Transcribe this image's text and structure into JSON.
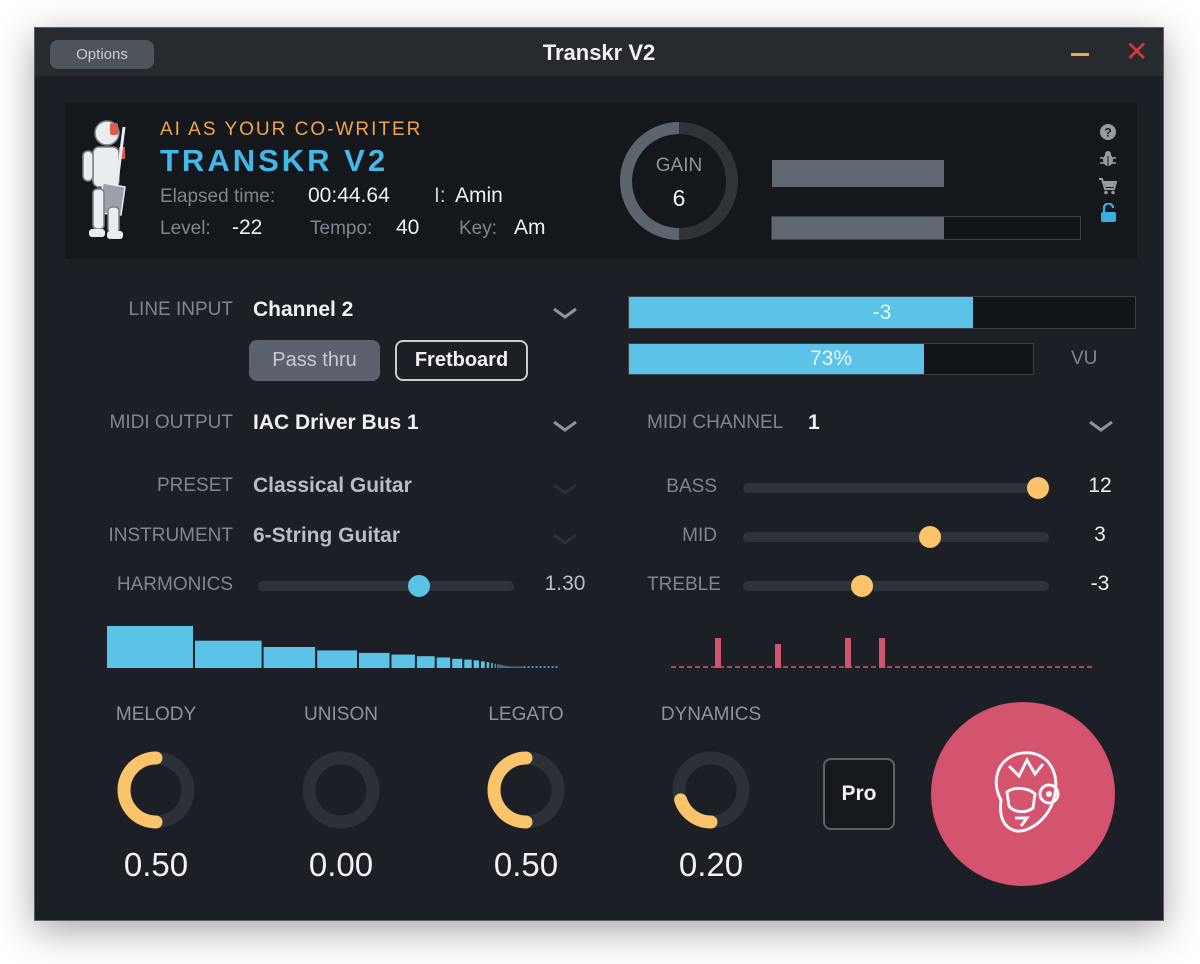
{
  "window": {
    "title": "Transkr V2",
    "options_label": "Options"
  },
  "header": {
    "tagline": "AI AS YOUR CO-WRITER",
    "brand": "TRANSKR V2",
    "elapsed_label": "Elapsed time:",
    "elapsed_value": "00:44.64",
    "chord_label": "I:",
    "chord_value": "Amin",
    "level_label": "Level:",
    "level_value": "-22",
    "tempo_label": "Tempo:",
    "tempo_value": "40",
    "key_label": "Key:",
    "key_value": "Am",
    "gain_label": "GAIN",
    "gain_value": "6",
    "gain_fraction": 0.5,
    "meter_top_fraction": 0.56,
    "meter_bottom_fraction": 0.56
  },
  "line_input": {
    "label": "LINE INPUT",
    "value": "Channel 2",
    "pass_thru_label": "Pass thru",
    "fretboard_label": "Fretboard",
    "meter_value": "-3",
    "meter_fraction": 0.68,
    "percent_value": "73%",
    "percent_fraction": 0.73,
    "vu_label": "VU"
  },
  "midi_output": {
    "label": "MIDI OUTPUT",
    "value": "IAC Driver Bus 1"
  },
  "midi_channel": {
    "label": "MIDI CHANNEL",
    "value": "1"
  },
  "preset": {
    "label": "PRESET",
    "value": "Classical Guitar"
  },
  "instrument": {
    "label": "INSTRUMENT",
    "value": "6-String Guitar"
  },
  "harmonics": {
    "label": "HARMONICS",
    "value": "1.30",
    "fraction": 0.64
  },
  "eq": {
    "bass": {
      "label": "BASS",
      "value": "12",
      "fraction": 1.0
    },
    "mid": {
      "label": "MID",
      "value": "3",
      "fraction": 0.62
    },
    "treble": {
      "label": "TREBLE",
      "value": "-3",
      "fraction": 0.38
    }
  },
  "harmonic_spectrum": [
    1.0,
    0.65,
    0.5,
    0.42,
    0.36,
    0.32,
    0.28,
    0.25,
    0.22,
    0.2,
    0.18,
    0.16,
    0.14,
    0.12,
    0.1,
    0.09,
    0.08,
    0.07,
    0.06,
    0.05,
    0.045,
    0.04,
    0.035,
    0.03,
    0.025,
    0.02,
    0.015,
    0.01
  ],
  "note_events": [
    0.75,
    0.6,
    0.75,
    0.75
  ],
  "knobs": [
    {
      "label": "MELODY",
      "value": "0.50",
      "fraction": 0.5
    },
    {
      "label": "UNISON",
      "value": "0.00",
      "fraction": 0.0
    },
    {
      "label": "LEGATO",
      "value": "0.50",
      "fraction": 0.5
    },
    {
      "label": "DYNAMICS",
      "value": "0.20",
      "fraction": 0.2
    }
  ],
  "pro_label": "Pro",
  "colors": {
    "accent_blue": "#5bc2e8",
    "accent_orange": "#fcc46a",
    "accent_pink": "#d4536e",
    "background": "#1c2026"
  },
  "icons": [
    "help-icon",
    "bug-icon",
    "cart-icon",
    "unlock-icon",
    "robot-mascot-icon",
    "robot-head-icon"
  ]
}
